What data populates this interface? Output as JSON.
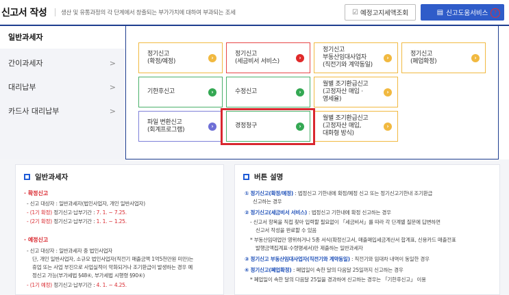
{
  "header": {
    "title": "신고서 작성",
    "description": "생산 및 유통과정의 각 단계에서 창출되는 부가가치에 대하여 부과되는 조세",
    "lookup_button": "예정고지세액조회",
    "guide_button": "신고도움서비스",
    "help": "?"
  },
  "nav": {
    "items": [
      {
        "label": "일반과세자",
        "arrow": ""
      },
      {
        "label": "간이과세자",
        "arrow": ">"
      },
      {
        "label": "대리납부",
        "arrow": ">"
      },
      {
        "label": "카드사 대리납부",
        "arrow": ">"
      }
    ]
  },
  "cards": [
    {
      "label": "정기신고\n(확정/예정)",
      "color": "#f1b940"
    },
    {
      "label": "정기신고\n(세금비서 서비스)",
      "color": "#e02a2a"
    },
    {
      "label": "정기신고\n부동산임대사업자\n(직전기와 계약동일)",
      "color": "#f1b940"
    },
    {
      "label": "정기신고\n(폐업확정)",
      "color": "#f1b940"
    },
    {
      "label": "기한후신고",
      "color": "#34a853"
    },
    {
      "label": "수정신고",
      "color": "#34a853"
    },
    {
      "label": "월별 조기환급신고\n(고정자산 매입 ·\n영세율)",
      "color": "#f1b940"
    },
    {
      "label": "파일 변환신고\n(회계프로그램)",
      "color": "#6e6fd6"
    },
    {
      "label": "경정청구",
      "color": "#34a853"
    },
    {
      "label": "월별 조기환급신고\n(고정자산 매입,\n대화형 방식)",
      "color": "#f1b940"
    }
  ],
  "left_panel": {
    "title": "일반과세자",
    "confirm_heading": "· 확정신고",
    "confirm_target": "- 신고 대상자 : 일반과세자(법인사업자, 개인 일반사업자)",
    "confirm_p1_label": "- (1기 확정)",
    "confirm_p1_text": "정기신고·납부기간 :",
    "confirm_p1_date": "7. 1. ~ 7.25.",
    "confirm_p2_label": "- (2기 확정)",
    "confirm_p2_text": "정기신고·납부기간 :",
    "confirm_p2_date": "1. 1. ~ 1.25.",
    "prelim_heading": "· 예정신고",
    "prelim_target": "- 신고 대상자 : 일반과세자 중 법인사업자",
    "prelim_l2": "단, 개인 일반사업자, 소규모 법인사업자(직전기 매출금액 1억5천만원 미만)는",
    "prelim_l3": "휴업 또는 사업 부진으로 사업실적이 악화되거나 조기환급이 발생하는 경우 예",
    "prelim_l4": "정신고 가능(부가세법 §48④, 부가세법 시행령 §90④)",
    "prelim_p1_label": "- (1기 예정)",
    "prelim_p1_text": "정기신고·납부기간 :",
    "prelim_p1_date": "4. 1. ~ 4.25."
  },
  "right_panel": {
    "title": "버튼 설명",
    "i1_head": "① 정기신고(확정/예정)",
    "i1_text": ": 법정신고 기한내에 확정/예정 신고 또는 정기신고기한내 조기환급",
    "i1_text2": "신고하는 경우",
    "i2_head": "② 정기신고(세금비서 서비스)",
    "i2_text": ": 법정신고 기한내에 확정 신고하는 경우",
    "i2_b1": "- 신고서 항목을 직접 찾아 입력할 필요없이 「세금비서」를 따라 각 단계별 질문에 답변하면",
    "i2_b1b": "신고서 작성을 완료할 수 있음",
    "i2_b2": "* 부동산임대업만 영위하거나 5종 서식(확정신고서, 매출매입세금계산서 합계표, 신용카드 매출전표",
    "i2_b2b": "발행금액집계표·수령명세서)만 제출하는 일반과세자",
    "i3_head": "③ 정기신고 부동산임대사업자(직전기와 계약동일)",
    "i3_text": ": 직전기와 임대차 내역이 동일한 경우",
    "i4_head": "④ 정기신고(폐업확정)",
    "i4_text": ": 폐업일이 속한 달의 다음달 25일까지 신고하는 경우",
    "i4_b1": "* 폐업일이 속한 달의 다음달 25일을 경과하여 신고하는 경우는 「기한후신고」 이용"
  }
}
